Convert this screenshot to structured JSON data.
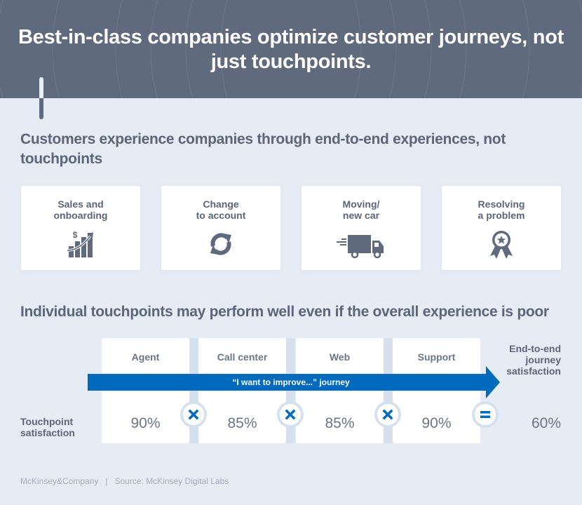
{
  "header": {
    "title": "Best-in-class companies optimize customer journeys, not just touchpoints."
  },
  "section1": {
    "heading": "Customers experience companies through end-to-end experiences, not touchpoints",
    "journeys": [
      {
        "label": "Sales and\nonboarding",
        "icon": "chart-dollar-growth-icon"
      },
      {
        "label": "Change\nto account",
        "icon": "refresh-cycle-icon"
      },
      {
        "label": "Moving/\nnew car",
        "icon": "moving-truck-icon"
      },
      {
        "label": "Resolving\na problem",
        "icon": "award-ribbon-icon"
      }
    ]
  },
  "section2": {
    "heading": "Individual touchpoints may perform well even if the overall experience is poor",
    "journey_arrow_label": "“I want to improve...” journey",
    "row_label": "Touchpoint\nsatisfaction",
    "touchpoints": [
      {
        "name": "Agent",
        "satisfaction": "90%"
      },
      {
        "name": "Call center",
        "satisfaction": "85%"
      },
      {
        "name": "Web",
        "satisfaction": "85%"
      },
      {
        "name": "Support",
        "satisfaction": "90%"
      }
    ],
    "operators": [
      "multiply",
      "multiply",
      "multiply",
      "equals"
    ],
    "result": {
      "label": "End-to-end\njourney\nsatisfaction",
      "value": "60%"
    }
  },
  "footer": {
    "brand": "McKinsey&Company",
    "separator": "|",
    "source": "Source: McKinsey Digital Labs"
  },
  "colors": {
    "header_bg": "#606a7d",
    "page_bg": "#e5ecf5",
    "accent_blue": "#006bbd",
    "text_dark": "#5d6578",
    "connector": "#d7e1ee"
  }
}
